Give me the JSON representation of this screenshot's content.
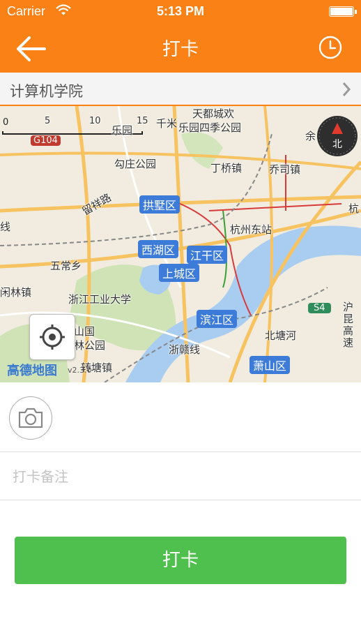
{
  "status_bar": {
    "carrier": "Carrier",
    "time": "5:13 PM"
  },
  "nav": {
    "title": "打卡",
    "back_icon": "arrow-left-icon",
    "history_icon": "clock-icon"
  },
  "location": {
    "name": "计算机学院"
  },
  "map": {
    "scale": {
      "ticks": [
        "0",
        "5",
        "10",
        "15"
      ],
      "unit": "千米"
    },
    "labels": [
      "天都城欢",
      "乐园",
      "乐园四季公园",
      "余",
      "勾庄公园",
      "丁桥镇",
      "乔司镇",
      "留祥路",
      "杭",
      "线",
      "杭州东站",
      "五常乡",
      "闲林镇",
      "浙江工业大学",
      "山国",
      "林公园",
      "北塘河",
      "浙赣线",
      "转塘镇",
      "沪昆高速"
    ],
    "districts": [
      "拱墅区",
      "西湖区",
      "江干区",
      "上城区",
      "滨江区",
      "萧山区"
    ],
    "road_badges": [
      "G104",
      "S4"
    ],
    "compass_label": "北",
    "logo": "高德地图",
    "logo_version": "v2.3.0"
  },
  "form": {
    "note_placeholder": "打卡备注",
    "submit_label": "打卡"
  },
  "colors": {
    "brand": "#f98116",
    "button": "#4fbf4e",
    "district": "#3c7bd8"
  }
}
